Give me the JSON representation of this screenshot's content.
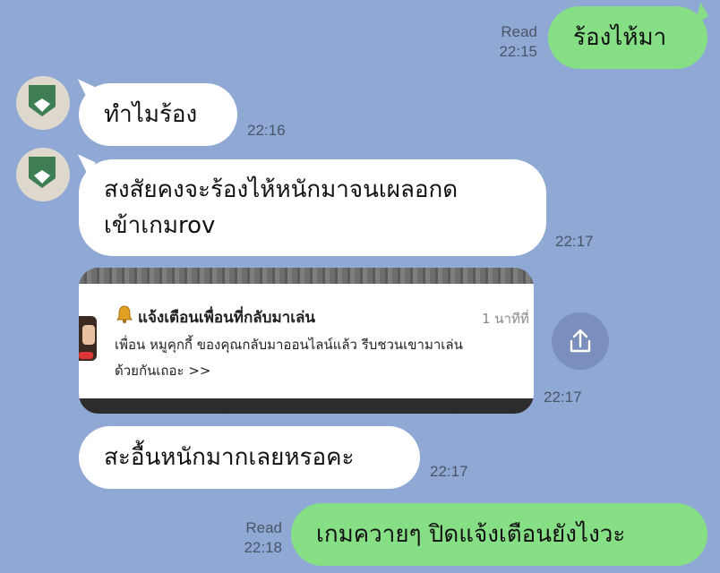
{
  "colors": {
    "background": "#8fa8d4",
    "incoming_bubble": "#ffffff",
    "outgoing_bubble": "#86de85",
    "meta_text": "#4a5568"
  },
  "messages": {
    "m1": {
      "text": "ร้องไห้มา",
      "status": "Read",
      "time": "22:15"
    },
    "m2": {
      "text": "ทำไมร้อง",
      "time": "22:16"
    },
    "m3": {
      "line1": "สงสัยคงจะร้องไห้หนักมาจนเผลอกด",
      "line2": "เข้าเกมrov",
      "time": "22:17"
    },
    "m4": {
      "title": "แจ้งเตือนเพื่อนที่กลับมาเล่น",
      "timeago": "1 นาทีที่",
      "body_line1": "เพื่อน หมูคุกกี้ ของคุณกลับมาออนไลน์แล้ว รีบชวนเขามาเล่น",
      "body_line2": "ด้วยกันเถอะ >>",
      "time": "22:17",
      "bell_icon": "bell-icon",
      "share_icon": "share-icon"
    },
    "m5": {
      "text": "สะอื้นหนักมากเลยหรอคะ",
      "time": "22:17"
    },
    "m6": {
      "text": "เกมควายๆ ปิดแจ้งเตือนยังไงวะ",
      "status": "Read",
      "time": "22:18"
    }
  }
}
